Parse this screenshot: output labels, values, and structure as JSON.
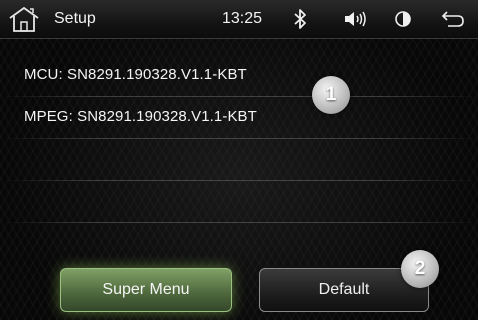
{
  "header": {
    "title": "Setup",
    "time": "13:25",
    "icons": [
      "home-icon",
      "bluetooth-icon",
      "volume-icon",
      "brightness-icon",
      "back-icon"
    ]
  },
  "info": {
    "mcu": "MCU: SN8291.190328.V1.1-KBT",
    "mpeg": "MPEG: SN8291.190328.V1.1-KBT"
  },
  "callouts": [
    "1",
    "2"
  ],
  "buttons": {
    "super_menu": "Super Menu",
    "default": "Default"
  },
  "colors": {
    "accent_green": "#6b8b55",
    "background": "#070707"
  }
}
